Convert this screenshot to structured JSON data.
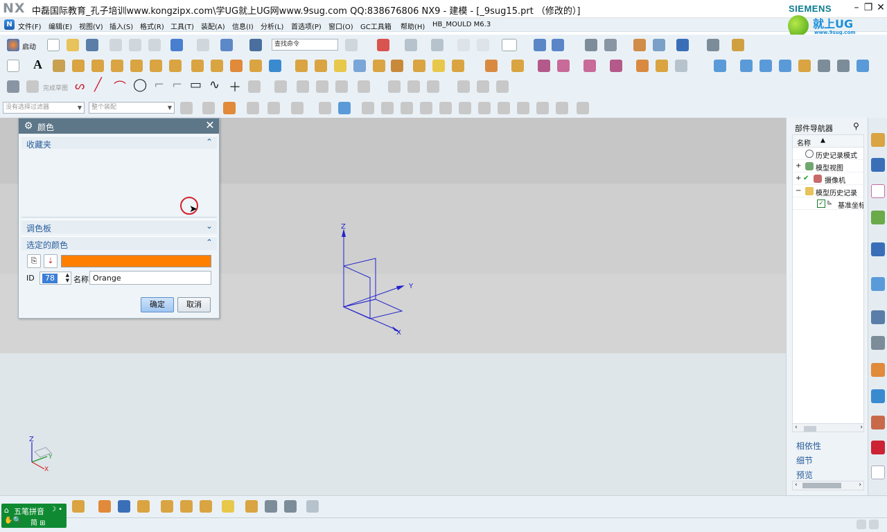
{
  "titlebar": {
    "logo": "NX",
    "title": "中磊国际教育_孔子培训www.kongzipx.com\\学UG就上UG网www.9sug.com QQ:838676806 NX9 - 建模 - [_9sug15.prt （修改的）]",
    "vendor": "SIEMENS",
    "extra_char": "5"
  },
  "brand": {
    "title": "就上UG网",
    "subtitle": "www.9sug.com"
  },
  "menu": {
    "items": [
      "文件(F)",
      "编辑(E)",
      "视图(V)",
      "插入(S)",
      "格式(R)",
      "工具(T)",
      "装配(A)",
      "信息(I)",
      "分析(L)",
      "首选项(P)",
      "窗口(O)",
      "GC工具箱",
      "帮助(H)",
      "HB_MOULD M6.3"
    ]
  },
  "toolbar": {
    "start_label": "启动",
    "search_command": "查找命令",
    "finish_sketch": "完成草图",
    "filter_select": "没有选择过滤器",
    "assembly_select": "整个装配"
  },
  "dialog": {
    "title": "颜色",
    "favorites_label": "收藏夹",
    "palette_label": "调色板",
    "selected_color_label": "选定的颜色",
    "selected_color_hex": "#ff8000",
    "id_label": "ID",
    "id_value": "78",
    "name_label": "名称",
    "name_value": "Orange",
    "ok_label": "确定",
    "cancel_label": "取消"
  },
  "viewport": {
    "axis_x": "X",
    "axis_y": "Y",
    "axis_z": "Z",
    "triad_x": "X",
    "triad_y": "Y",
    "triad_z": "Z"
  },
  "part_navigator": {
    "title": "部件导航器",
    "column_name": "名称",
    "sort_indicator": "▲",
    "nodes": [
      "历史记录模式",
      "模型视图",
      "摄像机",
      "模型历史记录",
      "基准坐标"
    ],
    "panels": [
      "相依性",
      "细节",
      "预览"
    ]
  },
  "ime": {
    "line1": "五笔拼音",
    "line2": "简 ⊞"
  },
  "colors": {
    "accent": "#2a5d9a",
    "dialog_title": "#5e7788",
    "selected": "#ff8000",
    "datum": "#2222cc"
  }
}
